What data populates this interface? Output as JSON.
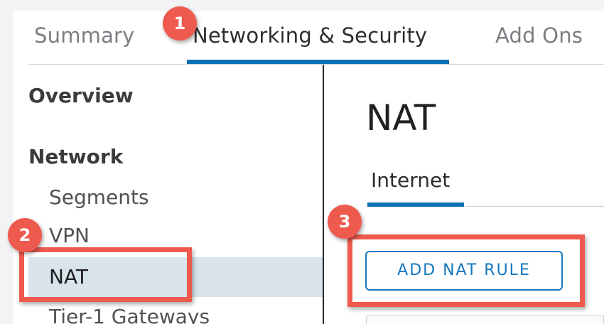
{
  "tabs": [
    {
      "label": "Summary"
    },
    {
      "label": "Networking & Security"
    },
    {
      "label": "Add Ons"
    }
  ],
  "sidebar": {
    "overview": "Overview",
    "network_heading": "Network",
    "items": [
      {
        "label": "Segments"
      },
      {
        "label": "VPN"
      },
      {
        "label": "NAT"
      },
      {
        "label": "Tier-1 Gateways"
      }
    ]
  },
  "main": {
    "title": "NAT",
    "subtabs": [
      {
        "label": "Internet"
      }
    ],
    "add_button_label": "ADD NAT RULE"
  },
  "annotations": {
    "step_1": "1",
    "step_2": "2",
    "step_3": "3"
  },
  "colors": {
    "accent": "#0d72b3",
    "callout": "#ef5a4f",
    "selected_bg": "#d8e3ea"
  }
}
